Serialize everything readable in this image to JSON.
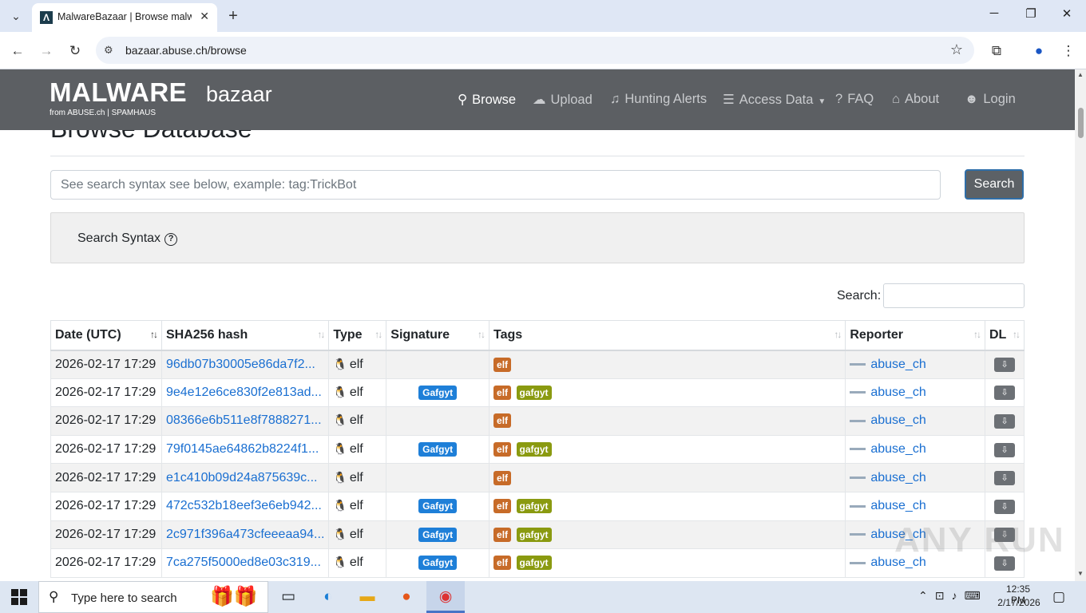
{
  "browser": {
    "tab_title": "MalwareBazaar | Browse malwa",
    "url": "bazaar.abuse.ch/browse",
    "new_tab": "+",
    "close_tab": "✕"
  },
  "site": {
    "logo_main": "MALWARE",
    "logo_sub": "bazaar",
    "logo_from": "from ABUSE.ch | SPAMHAUS",
    "nav": {
      "browse": "Browse",
      "upload": "Upload",
      "hunting": "Hunting Alerts",
      "access": "Access Data",
      "faq": "FAQ",
      "about": "About",
      "login": "Login"
    }
  },
  "page": {
    "title": "Browse Database",
    "search_placeholder": "See search syntax see below, example: tag:TrickBot",
    "search_button": "Search",
    "syntax_label": "Search Syntax",
    "dt_search_label": "Search:"
  },
  "table": {
    "headers": {
      "date": "Date (UTC)",
      "hash": "SHA256 hash",
      "type": "Type",
      "signature": "Signature",
      "tags": "Tags",
      "reporter": "Reporter",
      "dl": "DL"
    },
    "rows": [
      {
        "date": "2026-02-17 17:29",
        "hash": "96db07b30005e86da7f2...",
        "type": "elf",
        "signature": "",
        "tags": [
          "elf"
        ],
        "reporter": "abuse_ch"
      },
      {
        "date": "2026-02-17 17:29",
        "hash": "9e4e12e6ce830f2e813ad...",
        "type": "elf",
        "signature": "Gafgyt",
        "tags": [
          "elf",
          "gafgyt"
        ],
        "reporter": "abuse_ch"
      },
      {
        "date": "2026-02-17 17:29",
        "hash": "08366e6b511e8f7888271...",
        "type": "elf",
        "signature": "",
        "tags": [
          "elf"
        ],
        "reporter": "abuse_ch"
      },
      {
        "date": "2026-02-17 17:29",
        "hash": "79f0145ae64862b8224f1...",
        "type": "elf",
        "signature": "Gafgyt",
        "tags": [
          "elf",
          "gafgyt"
        ],
        "reporter": "abuse_ch"
      },
      {
        "date": "2026-02-17 17:29",
        "hash": "e1c410b09d24a875639c...",
        "type": "elf",
        "signature": "",
        "tags": [
          "elf"
        ],
        "reporter": "abuse_ch"
      },
      {
        "date": "2026-02-17 17:29",
        "hash": "472c532b18eef3e6eb942...",
        "type": "elf",
        "signature": "Gafgyt",
        "tags": [
          "elf",
          "gafgyt"
        ],
        "reporter": "abuse_ch"
      },
      {
        "date": "2026-02-17 17:29",
        "hash": "2c971f396a473cfeeeaa94...",
        "type": "elf",
        "signature": "Gafgyt",
        "tags": [
          "elf",
          "gafgyt"
        ],
        "reporter": "abuse_ch"
      },
      {
        "date": "2026-02-17 17:29",
        "hash": "7ca275f5000ed8e03c319...",
        "type": "elf",
        "signature": "Gafgyt",
        "tags": [
          "elf",
          "gafgyt"
        ],
        "reporter": "abuse_ch"
      }
    ]
  },
  "taskbar": {
    "search_placeholder": "Type here to search",
    "time": "12:35 PM",
    "date": "2/17/2026"
  },
  "watermark": "ANY RUN",
  "colors": {
    "navbar": "#5c5f63",
    "link": "#1a6fd1",
    "signature_badge": "#1e7fd8",
    "tag_elf": "#c76b28",
    "tag_gafgyt": "#8a9a10"
  }
}
